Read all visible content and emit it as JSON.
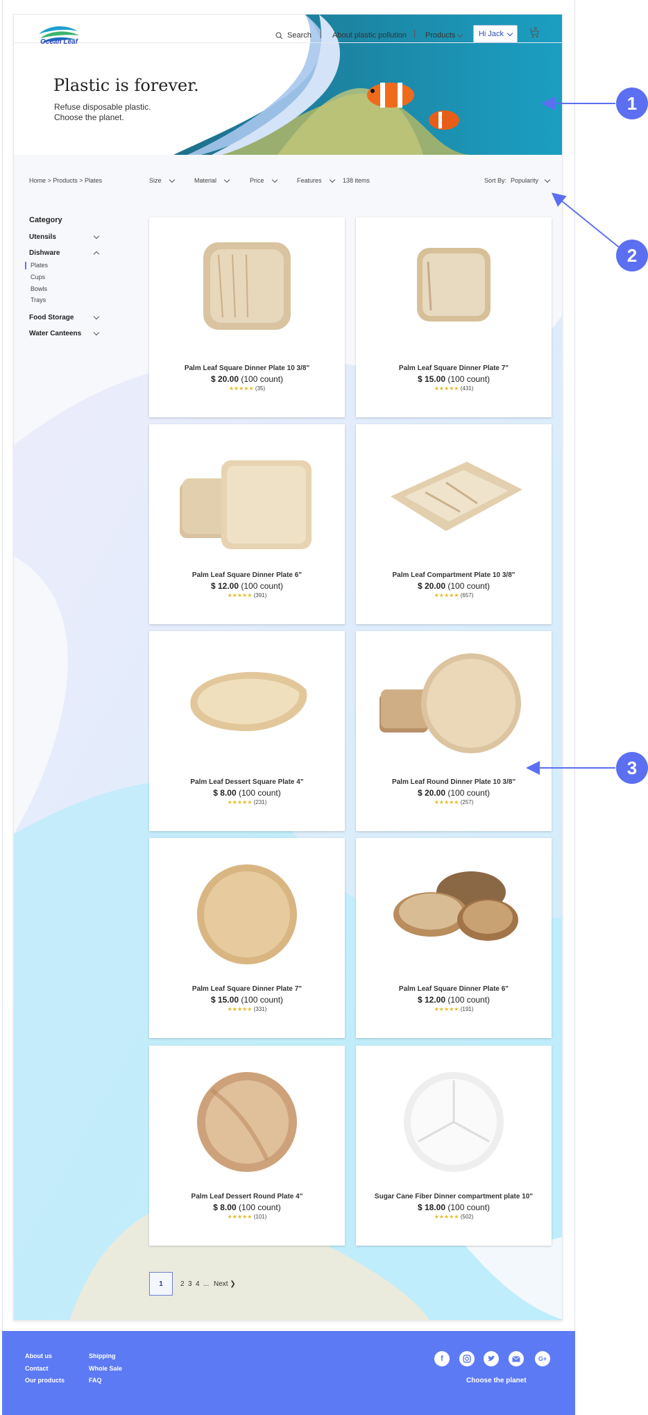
{
  "brand": {
    "name": "Ocean Leaf"
  },
  "nav": {
    "search": "Search",
    "separator": "|",
    "about": "About plastic pollution",
    "products": "Products",
    "user": "Hi Jack"
  },
  "hero": {
    "title": "Plastic is forever.",
    "subtitle_line1": "Refuse disposable plastic.",
    "subtitle_line2": "Choose the planet."
  },
  "breadcrumb": "Home > Products > Plates",
  "filters": {
    "size": "Size",
    "material": "Material",
    "price": "Price",
    "features": "Features",
    "count": "138 items",
    "sort_label": "Sort By:",
    "sort_value": "Popularity"
  },
  "sidebar": {
    "title": "Category",
    "utensils": "Utensils",
    "dishware": "Dishware",
    "plates": "Plates",
    "cups": "Cups",
    "bowls": "Bowls",
    "trays": "Trays",
    "food_storage": "Food Storage",
    "water_canteens": "Water Canteens"
  },
  "products": [
    {
      "name": "Palm Leaf Square Dinner Plate  10 3/8\"",
      "price": "$ 20.00",
      "count": "(100 count)",
      "stars": "★★★★★",
      "reviews": "(35)"
    },
    {
      "name": "Palm Leaf Square Dinner Plate  7\"",
      "price": "$ 15.00",
      "count": "(100 count)",
      "stars": "★★★★★",
      "reviews": "(431)"
    },
    {
      "name": "Palm Leaf Square Dinner Plate  6\"",
      "price": "$ 12.00",
      "count": "(100 count)",
      "stars": "★★★★★",
      "reviews": "(391)"
    },
    {
      "name": "Palm Leaf Compartment Plate  10 3/8\"",
      "price": "$ 20.00",
      "count": "(100 count)",
      "stars": "★★★★★",
      "reviews": "(657)"
    },
    {
      "name": "Palm Leaf Dessert Square Plate  4\"",
      "price": "$ 8.00",
      "count": "(100 count)",
      "stars": "★★★★★",
      "reviews": "(231)"
    },
    {
      "name": "Palm Leaf Round Dinner Plate  10 3/8\"",
      "price": "$ 20.00",
      "count": "(100 count)",
      "stars": "★★★★★",
      "reviews": "(257)"
    },
    {
      "name": "Palm Leaf Square Dinner Plate  7\"",
      "price": "$ 15.00",
      "count": "(100 count)",
      "stars": "★★★★★",
      "reviews": "(331)"
    },
    {
      "name": "Palm Leaf Square Dinner Plate  6\"",
      "price": "$ 12.00",
      "count": "(100 count)",
      "stars": "★★★★★",
      "reviews": "(191)"
    },
    {
      "name": "Palm Leaf Dessert Round Plate  4\"",
      "price": "$ 8.00",
      "count": "(100 count)",
      "stars": "★★★★★",
      "reviews": "(101)"
    },
    {
      "name": "Sugar Cane Fiber Dinner compartment plate 10\"",
      "price": "$ 18.00",
      "count": "(100 count)",
      "stars": "★★★★★",
      "reviews": "(502)"
    }
  ],
  "pagination": {
    "current": "1",
    "p2": "2",
    "p3": "3",
    "p4": "4",
    "ellipsis": "...",
    "next": "Next ❯"
  },
  "footer": {
    "about": "About us",
    "contact": "Contact",
    "our_products": "Our products",
    "shipping": "Shipping",
    "wholesale": "Whole Sale",
    "faq": "FAQ",
    "tagline": "Choose the planet",
    "social_icons": [
      "facebook-icon",
      "instagram-icon",
      "twitter-icon",
      "mail-icon",
      "google-plus-icon"
    ]
  },
  "annotations": [
    "1",
    "2",
    "3"
  ],
  "colors": {
    "accent": "#5d7af5",
    "annotation": "#5b6ff0",
    "link_blue": "#2d49b8",
    "star": "#e8b923"
  }
}
